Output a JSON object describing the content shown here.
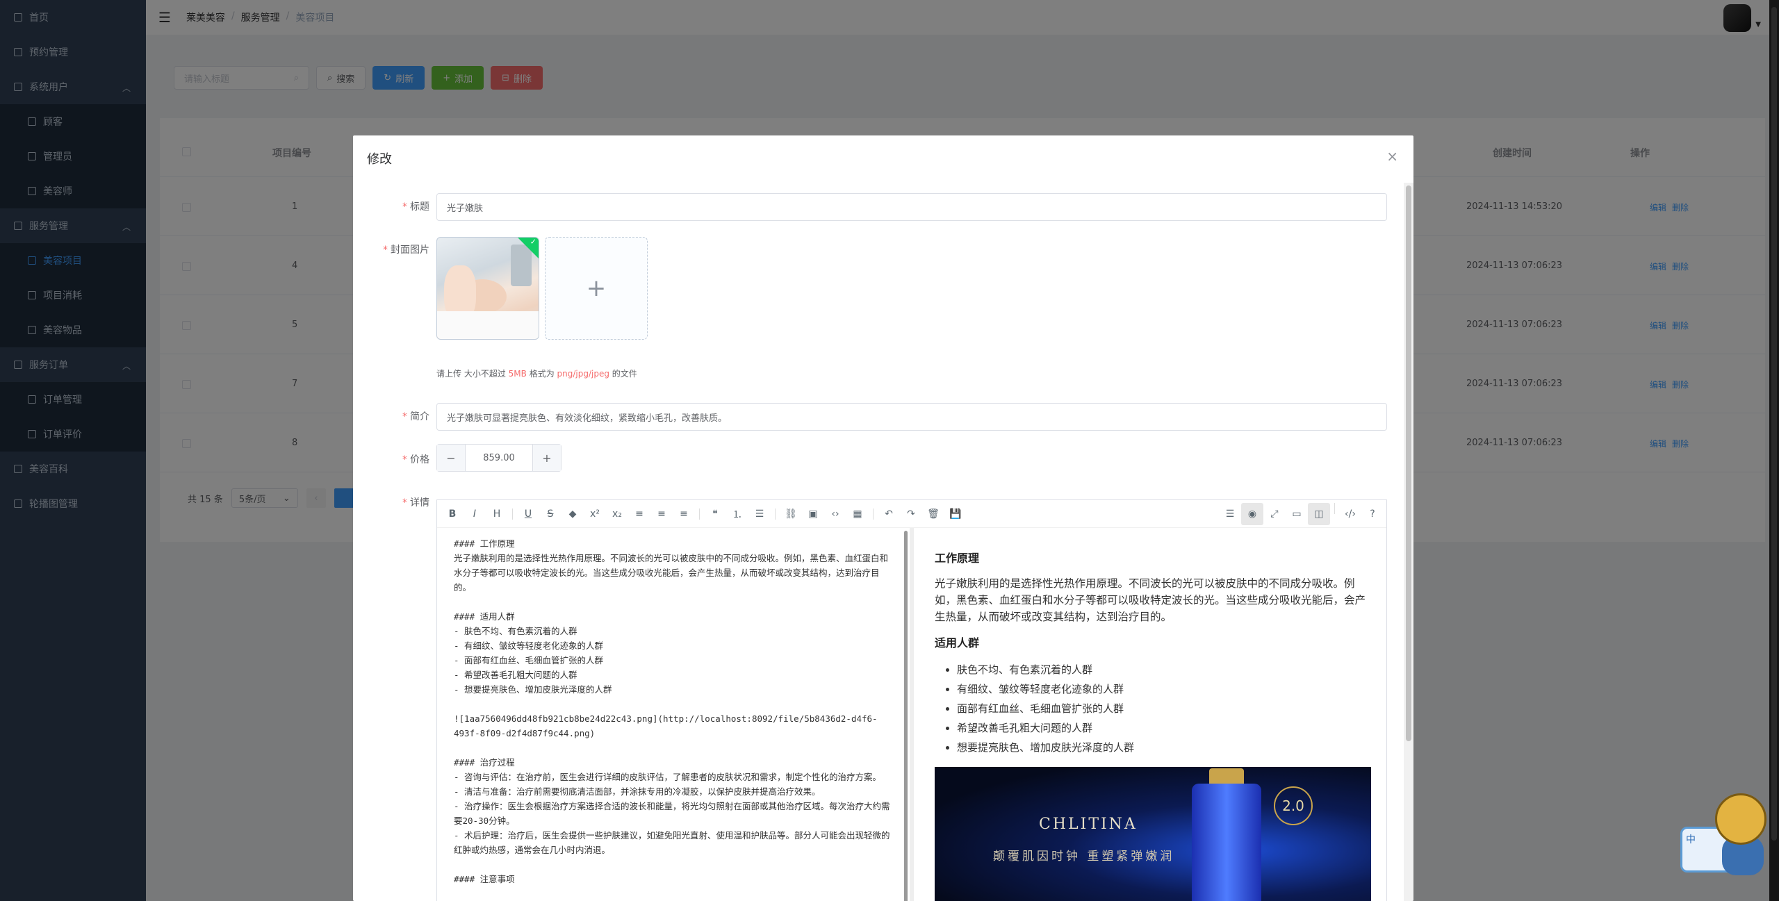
{
  "sidebar": {
    "items": [
      {
        "label": "首页",
        "level": 0
      },
      {
        "label": "预约管理",
        "level": 0
      },
      {
        "label": "系统用户",
        "level": 0,
        "expanded": true
      },
      {
        "label": "顾客",
        "level": 1
      },
      {
        "label": "管理员",
        "level": 1
      },
      {
        "label": "美容师",
        "level": 1
      },
      {
        "label": "服务管理",
        "level": 0,
        "expanded": true
      },
      {
        "label": "美容项目",
        "level": 1,
        "active": true
      },
      {
        "label": "项目消耗",
        "level": 1
      },
      {
        "label": "美容物品",
        "level": 1
      },
      {
        "label": "服务订单",
        "level": 0,
        "expanded": true
      },
      {
        "label": "订单管理",
        "level": 1
      },
      {
        "label": "订单评价",
        "level": 1
      },
      {
        "label": "美容百科",
        "level": 0
      },
      {
        "label": "轮播图管理",
        "level": 0
      }
    ]
  },
  "breadcrumb": [
    "莱美美容",
    "服务管理",
    "美容项目"
  ],
  "search": {
    "placeholder": "请输入标题"
  },
  "buttons": {
    "search": "搜索",
    "refresh": "刷新",
    "add": "添加",
    "delete": "删除"
  },
  "table": {
    "headers": {
      "id": "项目编号",
      "created": "创建时间",
      "ops": "操作"
    },
    "rows": [
      {
        "id": "1",
        "created": "2024-11-13 14:53:20"
      },
      {
        "id": "4",
        "created": "2024-11-13 07:06:23"
      },
      {
        "id": "5",
        "created": "2024-11-13 07:06:23"
      },
      {
        "id": "7",
        "created": "2024-11-13 07:06:23"
      },
      {
        "id": "8",
        "created": "2024-11-13 07:06:23"
      }
    ],
    "edit": "编辑",
    "del": "删除"
  },
  "pager": {
    "total": "共 15 条",
    "size": "5条/页"
  },
  "dialog": {
    "title": "修改",
    "labels": {
      "title": "标题",
      "cover": "封面图片",
      "intro": "简介",
      "price": "价格",
      "detail": "详情"
    },
    "title_value": "光子嫩肤",
    "tip_a": "请上传 大小不超过 ",
    "tip_size": "5MB",
    "tip_b": " 格式为 ",
    "tip_fmt": "png/jpg/jpeg",
    "tip_c": " 的文件",
    "intro_value": "光子嫩肤可显著提亮肤色、有效淡化细纹，紧致缩小毛孔，改善肤质。",
    "price_value": "859.00",
    "markdown": "#### 工作原理\n光子嫩肤利用的是选择性光热作用原理。不同波长的光可以被皮肤中的不同成分吸收。例如，黑色素、血红蛋白和水分子等都可以吸收特定波长的光。当这些成分吸收光能后，会产生热量，从而破坏或改变其结构，达到治疗目的。\n\n#### 适用人群\n- 肤色不均、有色素沉着的人群\n- 有细纹、皱纹等轻度老化迹象的人群\n- 面部有红血丝、毛细血管扩张的人群\n- 希望改善毛孔粗大问题的人群\n- 想要提亮肤色、增加皮肤光泽度的人群\n\n![1aa7560496dd48fb921cb8be24d22c43.png](http://localhost:8092/file/5b8436d2-d4f6-493f-8f09-d2f4d87f9c44.png)\n\n#### 治疗过程\n- 咨询与评估：在治疗前，医生会进行详细的皮肤评估，了解患者的皮肤状况和需求，制定个性化的治疗方案。\n- 清洁与准备：治疗前需要彻底清洁面部，并涂抹专用的冷凝胶，以保护皮肤并提高治疗效果。\n- 治疗操作：医生会根据治疗方案选择合适的波长和能量，将光均匀照射在面部或其他治疗区域。每次治疗大约需要20-30分钟。\n- 术后护理：治疗后，医生会提供一些护肤建议，如避免阳光直射、使用温和护肤品等。部分人可能会出现轻微的红肿或灼热感，通常会在几小时内消退。\n\n#### 注意事项",
    "preview": {
      "h1": "工作原理",
      "p1": "光子嫩肤利用的是选择性光热作用原理。不同波长的光可以被皮肤中的不同成分吸收。例如，黑色素、血红蛋白和水分子等都可以吸收特定波长的光。当这些成分吸收光能后，会产生热量，从而破坏或改变其结构，达到治疗目的。",
      "h2": "适用人群",
      "list": [
        "肤色不均、有色素沉着的人群",
        "有细纹、皱纹等轻度老化迹象的人群",
        "面部有红血丝、毛细血管扩张的人群",
        "希望改善毛孔粗大问题的人群",
        "想要提亮肤色、增加皮肤光泽度的人群"
      ],
      "banner_brand": "CHLITINA",
      "banner_slogan": "颠覆肌因时钟 重塑紧弹嫩润",
      "banner_badge": "2.0"
    }
  },
  "mascot": {
    "label": "中"
  }
}
